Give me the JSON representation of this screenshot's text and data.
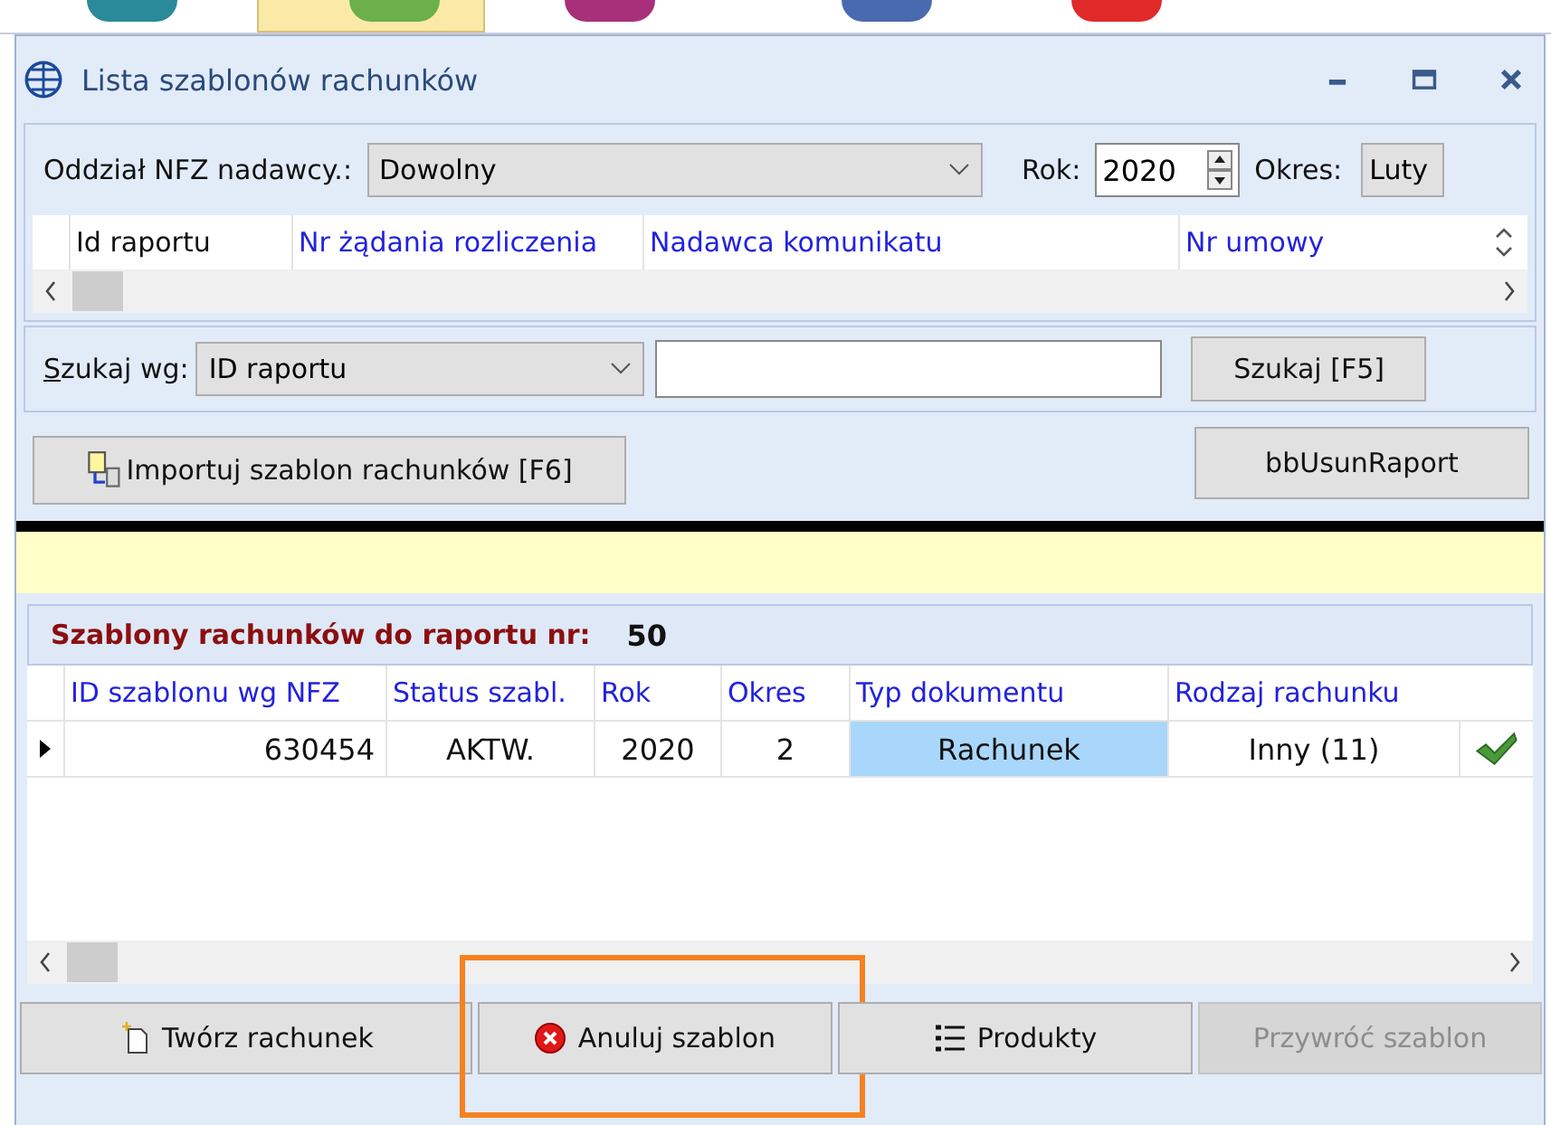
{
  "window": {
    "title": "Lista szablonów rachunków"
  },
  "filter": {
    "branch_label": "Oddział NFZ nadawcy.:",
    "branch_value": "Dowolny",
    "year_label": "Rok:",
    "year_value": "2020",
    "period_label": "Okres:",
    "period_value": "Luty"
  },
  "reports_table": {
    "columns": [
      "Id raportu",
      "Nr żądania rozliczenia",
      "Nadawca komunikatu",
      "Nr umowy"
    ]
  },
  "search": {
    "label": "Szukaj wg:",
    "field": "ID raportu",
    "button": "Szukaj [F5]"
  },
  "import_button": "Importuj szablon rachunków [F6]",
  "delete_button": "bbUsunRaport",
  "templates": {
    "title": "Szablony rachunków do raportu nr:",
    "report_number": "50",
    "columns": [
      "ID szablonu wg NFZ",
      "Status szabl.",
      "Rok",
      "Okres",
      "Typ dokumentu",
      "Rodzaj rachunku"
    ],
    "rows": [
      {
        "cells": [
          "630454",
          "AKTW.",
          "2020",
          "2",
          "Rachunek",
          "Inny (11)"
        ],
        "current": true,
        "valid": true
      }
    ]
  },
  "buttons": [
    {
      "label": "Twórz rachunek",
      "kind": "new",
      "disabled": false,
      "highlighted": false
    },
    {
      "label": "Anuluj szablon",
      "kind": "cancel",
      "disabled": false,
      "highlighted": true
    },
    {
      "label": "Produkty",
      "kind": "list",
      "disabled": false,
      "highlighted": false
    },
    {
      "label": "Przywróć szablon",
      "kind": "none",
      "disabled": true,
      "highlighted": false
    }
  ]
}
